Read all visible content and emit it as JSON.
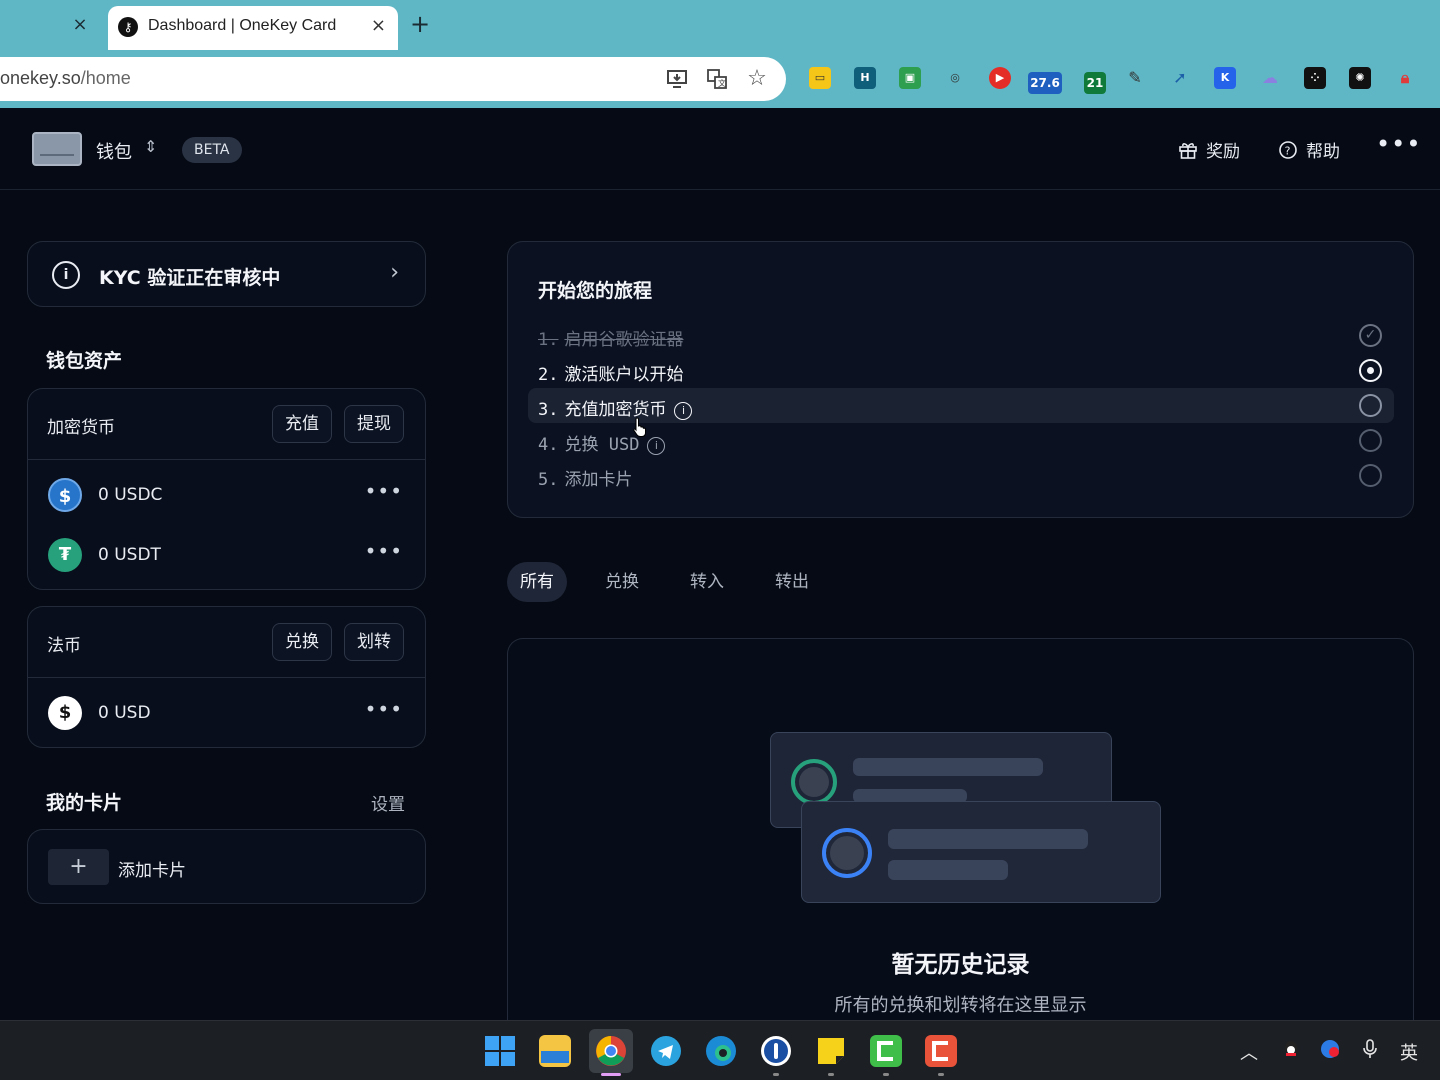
{
  "browser": {
    "tab_title": "Dashboard | OneKey Card",
    "tab_close": "×",
    "new_tab": "+",
    "url_host": "onekey.so",
    "url_path": "/home",
    "extension_badges": {
      "weather": "27.6",
      "mail": "21"
    }
  },
  "header": {
    "wallet_label": "钱包",
    "beta_badge": "BETA",
    "rewards_label": "奖励",
    "help_label": "帮助",
    "more": "•••"
  },
  "kyc": {
    "text": "KYC 验证正在审核中"
  },
  "wallet_assets": {
    "title": "钱包资产",
    "crypto": {
      "label": "加密货币",
      "deposit_label": "充值",
      "withdraw_label": "提现",
      "items": [
        {
          "amount": "0 USDC",
          "icon": "usdc-icon",
          "color": "#2775ca"
        },
        {
          "amount": "0 USDT",
          "icon": "usdt-icon",
          "color": "#26a17b"
        }
      ]
    },
    "fiat": {
      "label": "法币",
      "exchange_label": "兑换",
      "transfer_label": "划转",
      "items": [
        {
          "amount": "0 USD",
          "icon": "usd-icon",
          "color": "#ffffff"
        }
      ]
    }
  },
  "my_cards": {
    "title": "我的卡片",
    "settings_label": "设置",
    "add_card_label": "添加卡片"
  },
  "journey": {
    "title": "开始您的旅程",
    "steps": [
      {
        "num": "1.",
        "label": "启用谷歌验证器",
        "status": "done"
      },
      {
        "num": "2.",
        "label": "激活账户以开始",
        "status": "current"
      },
      {
        "num": "3.",
        "label": "充值加密货币",
        "status": "pending"
      },
      {
        "num": "4.",
        "label": "兑换 USD",
        "status": "pending"
      },
      {
        "num": "5.",
        "label": "添加卡片",
        "status": "pending"
      }
    ]
  },
  "history_tabs": [
    {
      "label": "所有",
      "active": true
    },
    {
      "label": "兑换",
      "active": false
    },
    {
      "label": "转入",
      "active": false
    },
    {
      "label": "转出",
      "active": false
    }
  ],
  "history": {
    "empty_title": "暂无历史记录",
    "empty_subtitle": "所有的兑换和划转将在这里显示"
  },
  "taskbar": {
    "ime": "英"
  },
  "colors": {
    "background": "#050a14",
    "tab_bar": "#5fb7c5",
    "card_border": "#232b3a",
    "accent_green": "#26a17b",
    "accent_blue": "#3b82f6"
  }
}
